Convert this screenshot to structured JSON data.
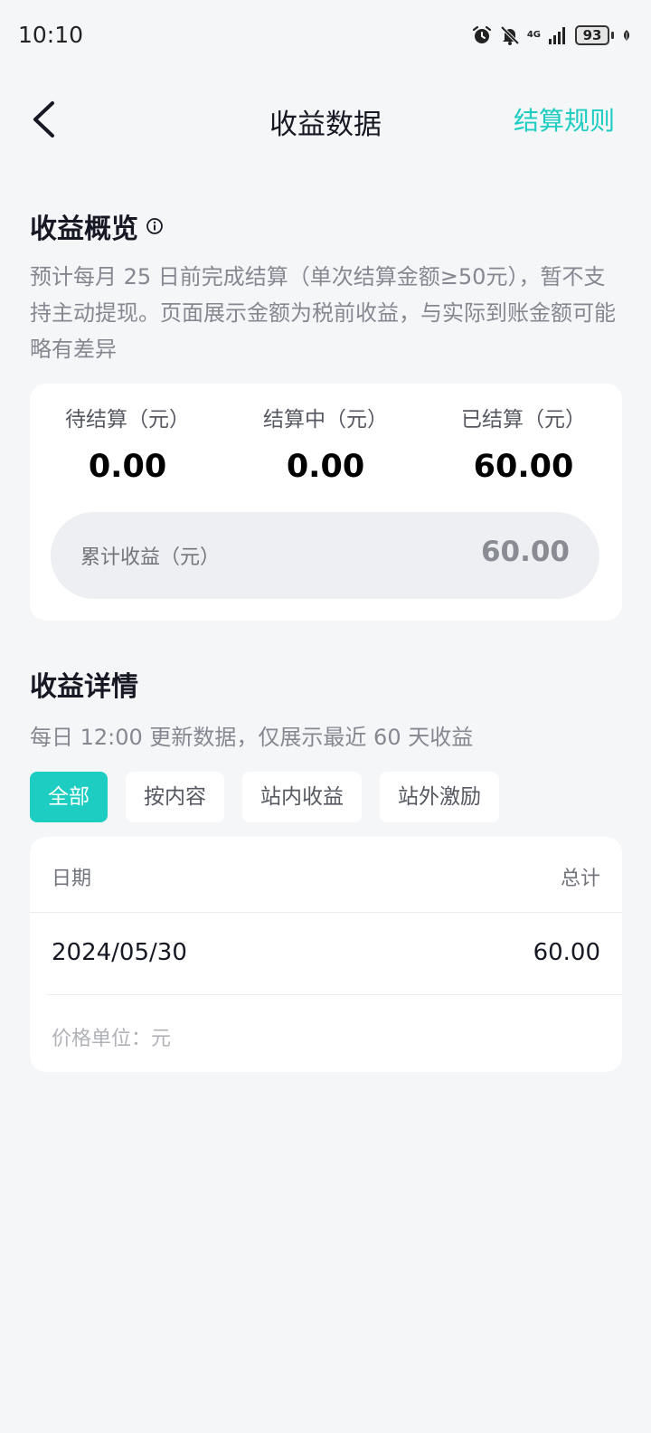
{
  "status_bar": {
    "time": "10:10",
    "network": "4G",
    "battery": "93",
    "icons": [
      "alarm-icon",
      "bell-off-icon",
      "signal-icon",
      "battery-icon",
      "leaf-icon"
    ]
  },
  "nav": {
    "back_icon": "chevron-left-icon",
    "title": "收益数据",
    "rule_link": "结算规则"
  },
  "overview": {
    "title": "收益概览",
    "info_icon": "info-icon",
    "description": "预计每月 25 日前完成结算（单次结算金额≥50元），暂不支持主动提现。页面展示金额为税前收益，与实际到账金额可能略有差异",
    "stats": [
      {
        "label": "待结算（元）",
        "value": "0.00"
      },
      {
        "label": "结算中（元）",
        "value": "0.00"
      },
      {
        "label": "已结算（元）",
        "value": "60.00"
      }
    ],
    "total": {
      "label": "累计收益（元）",
      "value": "60.00"
    }
  },
  "details": {
    "title": "收益详情",
    "description": "每日 12:00 更新数据，仅展示最近 60 天收益",
    "filters": [
      "全部",
      "按内容",
      "站内收益",
      "站外激励"
    ],
    "active_filter": "全部",
    "table": {
      "headers": [
        "日期",
        "总计"
      ],
      "rows": [
        {
          "date": "2024/05/30",
          "total": "60.00"
        }
      ],
      "footnote": "价格单位：元"
    }
  },
  "colors": {
    "accent": "#1ecdc2",
    "background": "#f5f6f8",
    "card": "#ffffff",
    "secondary_text": "#868891"
  }
}
